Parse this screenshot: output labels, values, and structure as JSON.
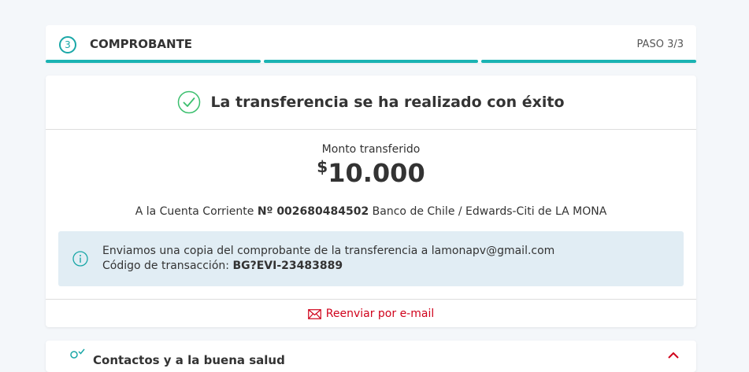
{
  "step": {
    "number": "3",
    "title": "COMPROBANTE",
    "counter": "PASO 3/3",
    "accent": "#1ab3b3"
  },
  "success": {
    "title": "La transferencia se ha realizado con éxito",
    "icon": "check-circle-icon",
    "color": "#3bbf6e"
  },
  "amount": {
    "label": "Monto transferido",
    "currency": "$",
    "value": "10.000"
  },
  "account": {
    "prefix": "A la Cuenta Corriente",
    "number": "Nº 002680484502",
    "suffix": "Banco de Chile / Edwards-Citi de LA MONA"
  },
  "info": {
    "icon": "info-icon",
    "line1": "Enviamos una copia del comprobante de la transferencia a lamonapv@gmail.com",
    "code_label": "Código de transacción:",
    "code_value": "BG?EVI-23483889"
  },
  "resend": {
    "label": "Reenviar por e-mail",
    "icon": "envelope-icon",
    "color": "#d0021b"
  },
  "next_section": {
    "title": "Contactos y a la buena salud",
    "icon": "person-check-icon"
  }
}
